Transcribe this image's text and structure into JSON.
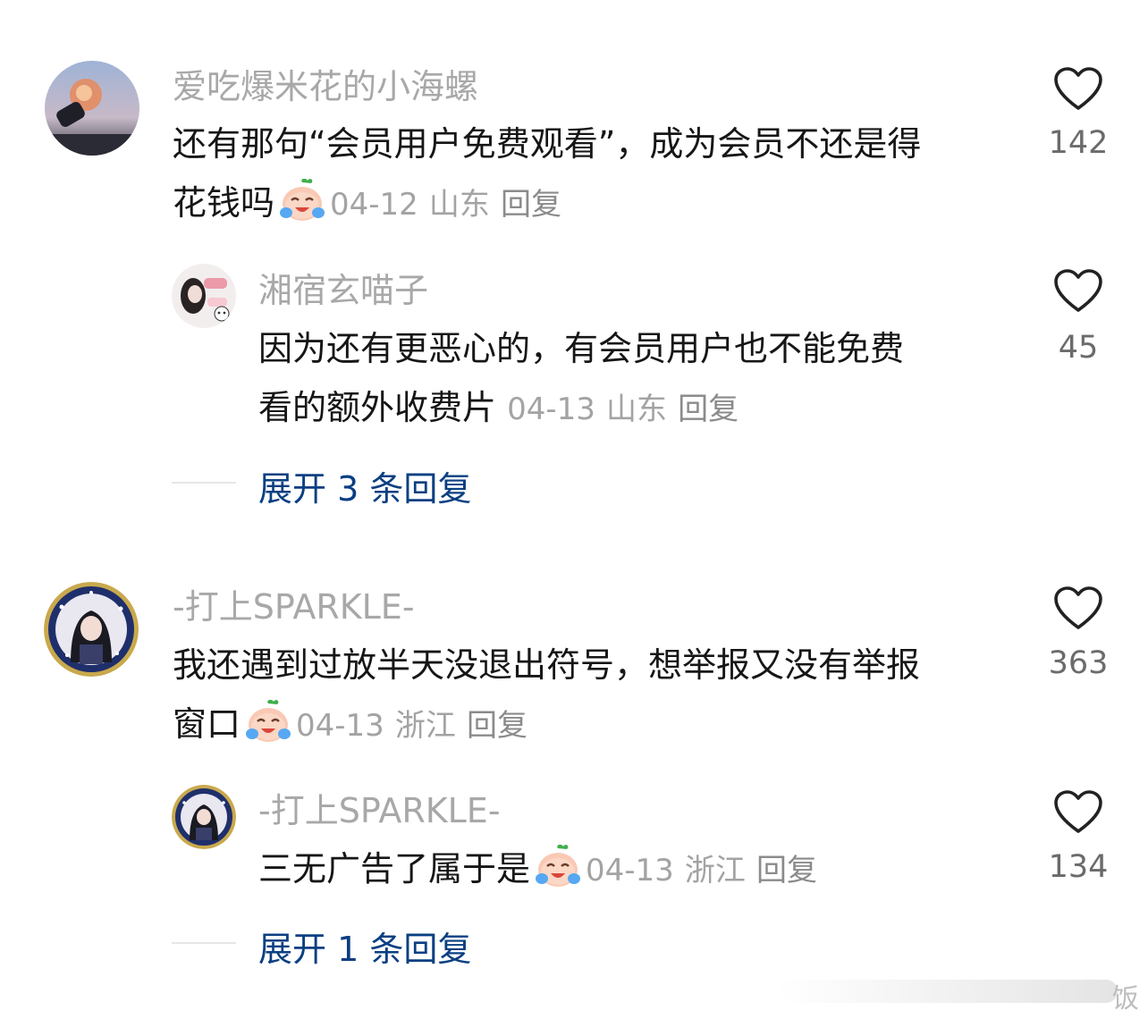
{
  "comments": [
    {
      "username": "爱吃爆米花的小海螺",
      "text_line1": "还有那句“会员用户免费观看”，成为会员不还是得",
      "text_line2": "花钱吗",
      "date": "04-12",
      "location": "山东",
      "reply_label": "回复",
      "likes": "142",
      "reply": {
        "username": "湘宿玄喵子",
        "text_line1": "因为还有更恶心的，有会员用户也不能免费",
        "text_line2": "看的额外收费片",
        "date": "04-13",
        "location": "山东",
        "reply_label": "回复",
        "likes": "45"
      },
      "expand_label": "展开 3 条回复"
    },
    {
      "username": "-打上SPARKLE-",
      "text_line1": "我还遇到过放半天没退出符号，想举报又没有举报",
      "text_line2": "窗口",
      "date": "04-13",
      "location": "浙江",
      "reply_label": "回复",
      "likes": "363",
      "reply": {
        "username": "-打上SPARKLE-",
        "text_line1": "三无广告了属于是",
        "date": "04-13",
        "location": "浙江",
        "reply_label": "回复",
        "likes": "134"
      },
      "expand_label": "展开 1 条回复"
    }
  ],
  "watermark": "饭",
  "colors": {
    "username": "#a8a8a8",
    "text": "#161616",
    "meta": "#a3a3a3",
    "expand": "#0a3f82"
  },
  "icons": {
    "like": "heart-outline-icon",
    "emoji": "crying-laughing-peach-emoji"
  }
}
